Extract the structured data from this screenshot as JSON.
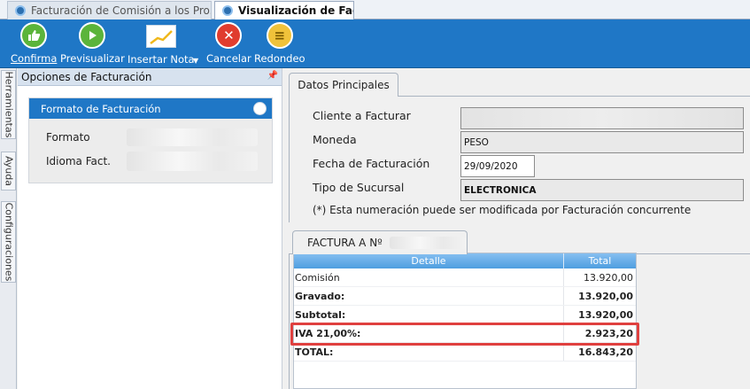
{
  "tabs": [
    {
      "label": "Facturación de Comisión a los Pro..."
    },
    {
      "label": "Visualización de Factura"
    }
  ],
  "toolbar": {
    "confirma": "Confirma",
    "previsualizar": "Previsualizar",
    "insertar_nota": "Insertar Nota",
    "cancelar": "Cancelar",
    "redondeo": "Redondeo"
  },
  "sidebar_tabs": [
    "Herramientas",
    "Ayuda",
    "Configuraciones"
  ],
  "left_panel": {
    "title": "Opciones de Facturación",
    "formato_box": {
      "title": "Formato de Facturación",
      "formato_label": "Formato",
      "idioma_label": "Idioma Fact."
    }
  },
  "datos_principales": {
    "tab_label": "Datos Principales",
    "cliente_label": "Cliente a Facturar",
    "moneda_label": "Moneda",
    "moneda_value": "PESO",
    "fecha_label": "Fecha de Facturación",
    "fecha_value": "29/09/2020",
    "sucursal_label": "Tipo de Sucursal",
    "sucursal_value": "ELECTRONICA",
    "note": "(*) Esta numeración puede ser modificada por Facturación concurrente"
  },
  "factura": {
    "tab_label": "FACTURA A Nº",
    "columns": [
      "Detalle",
      "Total"
    ],
    "rows": [
      {
        "detalle": "Comisión",
        "total": "13.920,00"
      },
      {
        "detalle": "Gravado:",
        "total": "13.920,00"
      },
      {
        "detalle": "Subtotal:",
        "total": "13.920,00"
      },
      {
        "detalle": "IVA 21,00%:",
        "total": "2.923,20"
      },
      {
        "detalle": "TOTAL:",
        "total": "16.843,20"
      }
    ]
  }
}
